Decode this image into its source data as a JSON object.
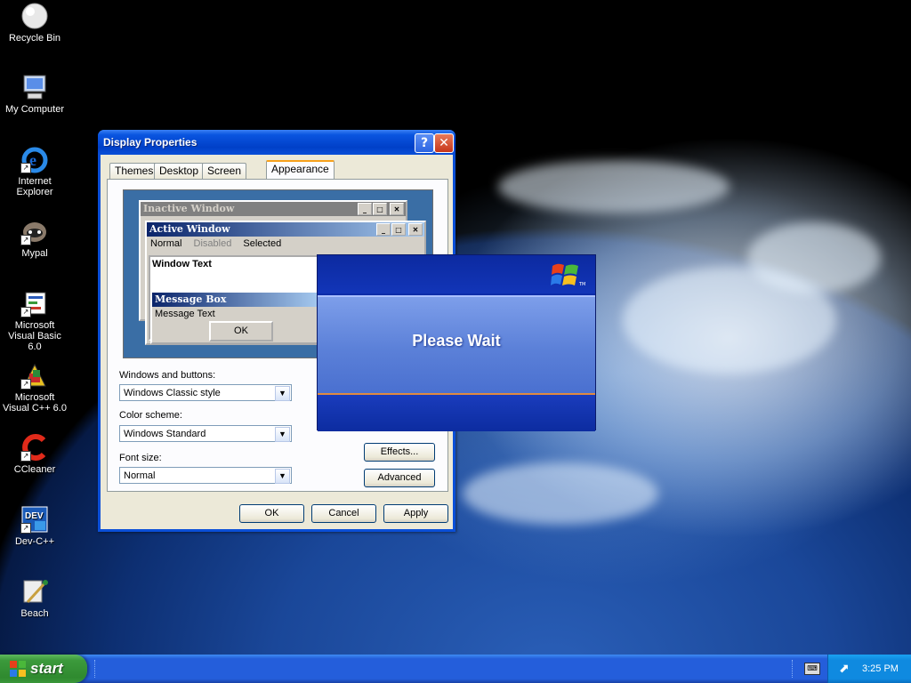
{
  "desktop": {
    "icons": [
      {
        "label": "Recycle Bin"
      },
      {
        "label": "My Computer"
      },
      {
        "label": "Internet Explorer"
      },
      {
        "label": "Mypal"
      },
      {
        "label": "Microsoft Visual Basic 6.0"
      },
      {
        "label": "Microsoft Visual C++ 6.0"
      },
      {
        "label": "CCleaner"
      },
      {
        "label": "Dev-C++"
      },
      {
        "label": "Beach"
      }
    ]
  },
  "dialog": {
    "title": "Display Properties",
    "help_label": "?",
    "close_label": "✕",
    "tabs": [
      "Themes",
      "Desktop",
      "Screen Saver",
      "Appearance"
    ],
    "active_tab": "Appearance",
    "preview": {
      "inactive_title": "Inactive Window",
      "active_title": "Active Window",
      "menu": [
        "Normal",
        "Disabled",
        "Selected"
      ],
      "window_text": "Window Text",
      "msgbox_title": "Message Box",
      "msgbox_text": "Message Text",
      "msgbox_ok": "OK"
    },
    "windows_buttons_label": "Windows and buttons:",
    "windows_buttons_value": "Windows Classic style",
    "color_scheme_label": "Color scheme:",
    "color_scheme_value": "Windows Standard",
    "font_size_label": "Font size:",
    "font_size_value": "Normal",
    "effects_label": "Effects...",
    "advanced_label": "Advanced",
    "ok_label": "OK",
    "cancel_label": "Cancel",
    "apply_label": "Apply"
  },
  "wait_dialog": {
    "message": "Please Wait",
    "logo_mark": "TM"
  },
  "taskbar": {
    "start_label": "start",
    "clock": "3:25 PM"
  },
  "colors": {
    "xp_blue": "#0a4fd8",
    "start_green": "#3c9a3c",
    "dialog_face": "#ece9d8",
    "classic_face": "#d4d0c8"
  }
}
